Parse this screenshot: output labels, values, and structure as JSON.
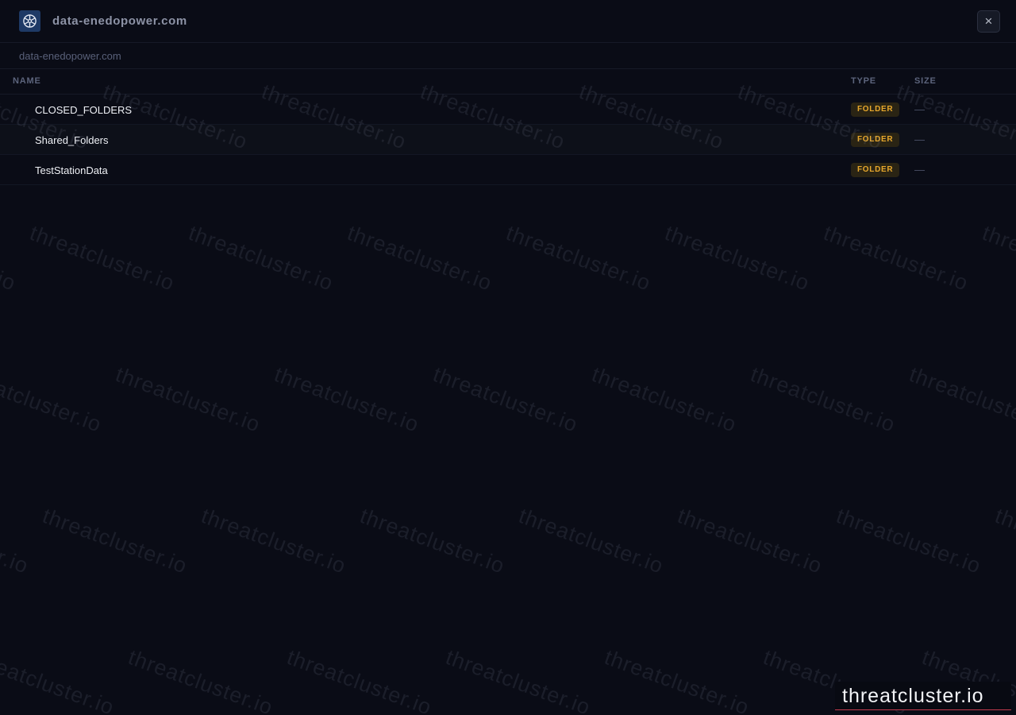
{
  "header": {
    "title": "data-enedopower.com",
    "logo_icon": "snowflake-logo-icon",
    "close_label": "×"
  },
  "breadcrumb": {
    "items": [
      "data-enedopower.com"
    ]
  },
  "table": {
    "columns": [
      "NAME",
      "TYPE",
      "SIZE"
    ],
    "rows": [
      {
        "name": "CLOSED_FOLDERS",
        "type": "FOLDER",
        "size": "—"
      },
      {
        "name": "Shared_Folders",
        "type": "FOLDER",
        "size": "—"
      },
      {
        "name": "TestStationData",
        "type": "FOLDER",
        "size": "—"
      }
    ]
  },
  "watermark": {
    "text": "threatcluster.io"
  },
  "colors": {
    "background": "#0a0c16",
    "badge_text": "#e8a82c",
    "badge_bg": "#2a2414",
    "accent_line": "#c23a4e"
  }
}
